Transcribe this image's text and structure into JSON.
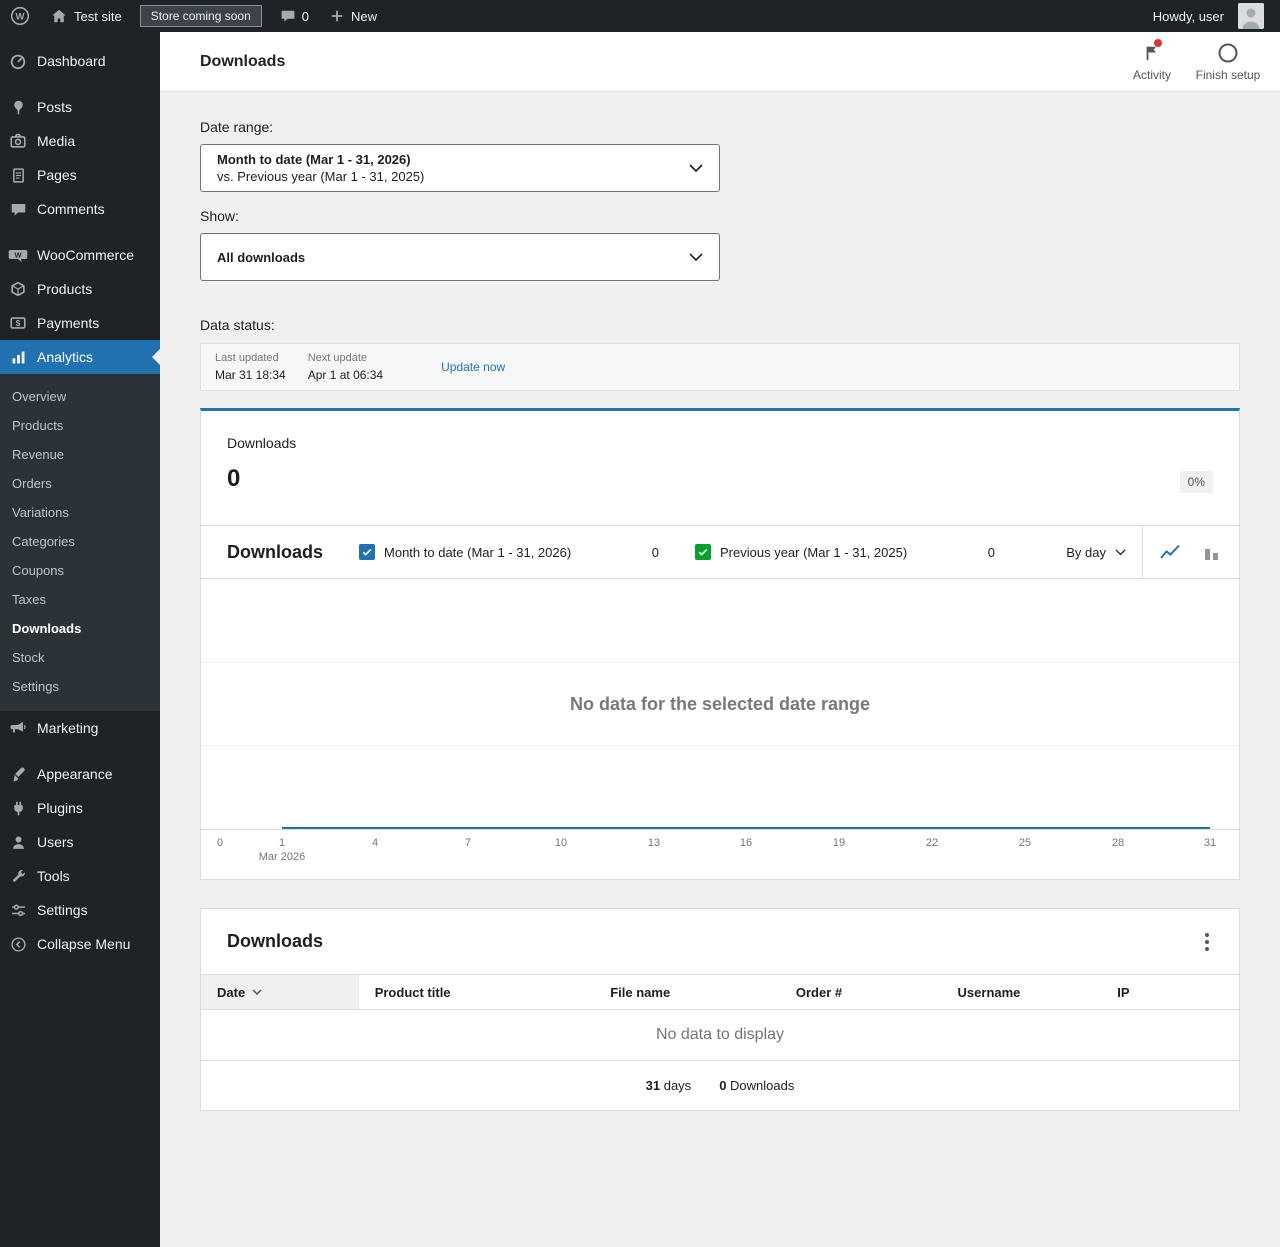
{
  "admin_bar": {
    "site_name": "Test site",
    "store_badge": "Store coming soon",
    "comments_count": "0",
    "new_label": "New",
    "howdy": "Howdy, user"
  },
  "sidebar": {
    "top_items": [
      {
        "label": "Dashboard",
        "icon": "dashboard-icon"
      },
      {
        "label": "Posts",
        "icon": "pin-icon"
      },
      {
        "label": "Media",
        "icon": "camera-icon"
      },
      {
        "label": "Pages",
        "icon": "page-icon"
      },
      {
        "label": "Comments",
        "icon": "comment-icon"
      }
    ],
    "woo_items": [
      {
        "label": "WooCommerce",
        "icon": "woocommerce-icon"
      },
      {
        "label": "Products",
        "icon": "box-icon"
      },
      {
        "label": "Payments",
        "icon": "payments-icon"
      }
    ],
    "analytics": {
      "label": "Analytics",
      "icon": "bar-chart-icon"
    },
    "analytics_submenu": [
      "Overview",
      "Products",
      "Revenue",
      "Orders",
      "Variations",
      "Categories",
      "Coupons",
      "Taxes",
      "Downloads",
      "Stock",
      "Settings"
    ],
    "current_submenu_item": "Downloads",
    "marketing": {
      "label": "Marketing",
      "icon": "megaphone-icon"
    },
    "bottom_items": [
      {
        "label": "Appearance",
        "icon": "brush-icon"
      },
      {
        "label": "Plugins",
        "icon": "plug-icon"
      },
      {
        "label": "Users",
        "icon": "user-icon"
      },
      {
        "label": "Tools",
        "icon": "wrench-icon"
      },
      {
        "label": "Settings",
        "icon": "sliders-icon"
      }
    ],
    "collapse": {
      "label": "Collapse Menu",
      "icon": "collapse-arrow-icon"
    }
  },
  "header": {
    "title": "Downloads",
    "activity_label": "Activity",
    "finish_setup_label": "Finish setup"
  },
  "filters": {
    "date_range_label": "Date range:",
    "date_range_primary": "Month to date (Mar 1 - 31, 2026)",
    "date_range_secondary": "vs. Previous year (Mar 1 - 31, 2025)",
    "show_label": "Show:",
    "show_value": "All downloads"
  },
  "data_status": {
    "label": "Data status:",
    "last_updated_label": "Last updated",
    "last_updated_value": "Mar 31 18:34",
    "next_update_label": "Next update",
    "next_update_value": "Apr 1 at 06:34",
    "update_now_label": "Update now"
  },
  "summary": {
    "title": "Downloads",
    "value": "0",
    "delta": "0%"
  },
  "chart": {
    "title": "Downloads",
    "interval": "By day",
    "empty_message": "No data for the selected date range",
    "legend": [
      {
        "label": "Month to date (Mar 1 - 31, 2026)",
        "value": "0",
        "color": "#2271b1"
      },
      {
        "label": "Previous year (Mar 1 - 31, 2025)",
        "value": "0",
        "color": "#00a32a"
      }
    ],
    "y_tick": "0",
    "x_ticks": [
      "1",
      "4",
      "7",
      "10",
      "13",
      "16",
      "19",
      "22",
      "25",
      "28",
      "31"
    ],
    "x_month_label": "Mar 2026"
  },
  "chart_data": {
    "type": "line",
    "title": "Downloads",
    "interval": "By day",
    "x_ticks": [
      "1",
      "4",
      "7",
      "10",
      "13",
      "16",
      "19",
      "22",
      "25",
      "28",
      "31"
    ],
    "x_axis_month": "Mar 2026",
    "y_ticks": [
      "0"
    ],
    "series": [
      {
        "name": "Month to date (Mar 1 - 31, 2026)",
        "total": 0,
        "values": []
      },
      {
        "name": "Previous year (Mar 1 - 31, 2025)",
        "total": 0,
        "values": []
      }
    ],
    "empty_message": "No data for the selected date range"
  },
  "table": {
    "title": "Downloads",
    "columns": [
      {
        "label": "Date"
      },
      {
        "label": "Product title"
      },
      {
        "label": "File name"
      },
      {
        "label": "Order #"
      },
      {
        "label": "Username"
      },
      {
        "label": "IP"
      }
    ],
    "sorted_column": "Date",
    "empty_message": "No data to display",
    "summary": [
      {
        "value": "31",
        "label": "days"
      },
      {
        "value": "0",
        "label": "Downloads"
      }
    ]
  },
  "colors": {
    "accent": "#2271b1",
    "sidebar_bg": "#1d2327",
    "submenu_bg": "#2c3338",
    "content_bg": "#f0f0f1",
    "series_primary": "#2271b1",
    "series_secondary": "#00a32a",
    "notification_red": "#d63638"
  }
}
